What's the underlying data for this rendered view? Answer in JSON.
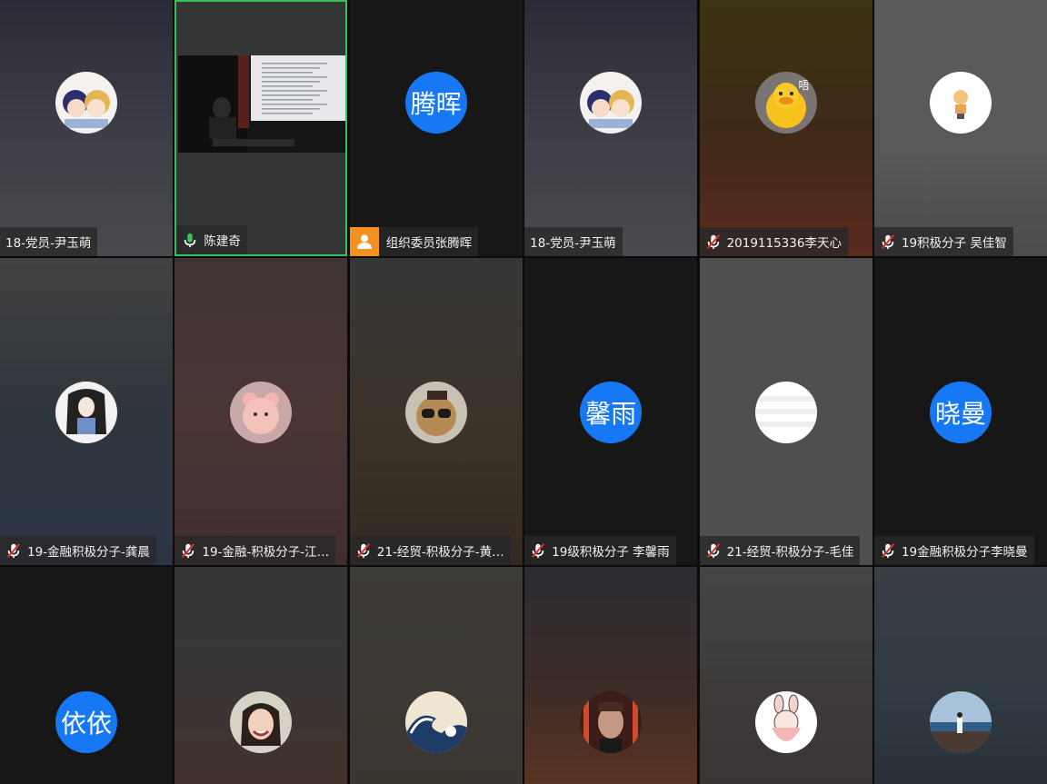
{
  "participants": [
    {
      "name": "18-党员-尹玉萌",
      "mic": "none",
      "avatar_kind": "image",
      "avatar_icon": "couple-cartoon-icon",
      "bg": "linear-gradient(180deg,#2a2b36 0%,#3b3c45 45%,#4a4a4e 100%)"
    },
    {
      "name": "陈建奇",
      "mic": "on",
      "avatar_kind": "video",
      "active": true,
      "bg": "#343636"
    },
    {
      "name": "组织委员张腾晖",
      "mic": "person",
      "avatar_kind": "text",
      "avatar_text": "腾晖",
      "bg": "#171717"
    },
    {
      "name": "18-党员-尹玉萌",
      "mic": "none",
      "avatar_kind": "image",
      "avatar_icon": "couple-cartoon-icon",
      "bg": "linear-gradient(180deg,#2a2b36 0%,#3b3c45 45%,#4a4a4e 100%)"
    },
    {
      "name": "2019115336李天心",
      "mic": "muted",
      "avatar_kind": "image",
      "avatar_icon": "yellow-duck-icon",
      "avatar_badge": "唔",
      "bg": "linear-gradient(180deg,#3d3412 0%,#3f2a18 50%,#5a2a1e 100%)"
    },
    {
      "name": "19积极分子 吴佳智",
      "mic": "muted",
      "avatar_kind": "image",
      "avatar_icon": "cartoon-boy-icon",
      "bg": "linear-gradient(180deg,#5a5a5a 0%,#595959 60%,#4b4b4b 100%)"
    },
    {
      "name": "19-金融积极分子-龚晨",
      "mic": "muted",
      "avatar_kind": "image",
      "avatar_icon": "long-hair-girl-icon",
      "bg": "linear-gradient(180deg,#424242 0%,#2f353c 50%,#2a3545 100%)"
    },
    {
      "name": "19-金融-积极分子-江…",
      "mic": "muted",
      "avatar_kind": "image",
      "avatar_icon": "pink-bear-icon",
      "bg": "linear-gradient(180deg,#3f3434 0%,#4b3535 50%,#3f2e2e 100%)"
    },
    {
      "name": "21-经贸-积极分子-黄…",
      "mic": "muted",
      "avatar_kind": "image",
      "avatar_icon": "sunglasses-dog-icon",
      "bg": "linear-gradient(180deg,#363636 0%,#3c342b 50%,#342a22 100%)"
    },
    {
      "name": "19级积极分子 李馨雨",
      "mic": "muted",
      "avatar_kind": "text",
      "avatar_text": "馨雨",
      "bg": "#171717"
    },
    {
      "name": "21-经贸-积极分子-毛佳",
      "mic": "muted",
      "avatar_kind": "image",
      "avatar_icon": "striped-white-icon",
      "bg": "#4f4f4f"
    },
    {
      "name": "19金融积极分子李晓曼",
      "mic": "muted",
      "avatar_kind": "text",
      "avatar_text": "晓曼",
      "bg": "#171717"
    },
    {
      "name": "",
      "mic": "none",
      "avatar_kind": "text",
      "avatar_text": "依依",
      "bg": "#171717"
    },
    {
      "name": "",
      "mic": "none",
      "avatar_kind": "image",
      "avatar_icon": "smiling-girl-icon",
      "bg": "linear-gradient(180deg,#343638 0%,#3a3534 60%,#43322c 100%)"
    },
    {
      "name": "",
      "mic": "none",
      "avatar_kind": "image",
      "avatar_icon": "great-wave-icon",
      "bg": "linear-gradient(180deg,#3d3b37 0%,#3c3833 60%,#3a3530 100%)"
    },
    {
      "name": "",
      "mic": "none",
      "avatar_kind": "image",
      "avatar_icon": "portrait-man-icon",
      "bg": "linear-gradient(180deg,#2b2d33 0%,#3a2b28 50%,#5a3322 100%)"
    },
    {
      "name": "",
      "mic": "none",
      "avatar_kind": "image",
      "avatar_icon": "bunny-girl-icon",
      "bg": "linear-gradient(180deg,#454545 0%,#3e3a3a 60%,#3a3535 100%)"
    },
    {
      "name": "",
      "mic": "none",
      "avatar_kind": "image",
      "avatar_icon": "sea-landscape-icon",
      "bg": "linear-gradient(180deg,#3a3f44 0%,#303a42 60%,#2a3038 100%)"
    }
  ]
}
